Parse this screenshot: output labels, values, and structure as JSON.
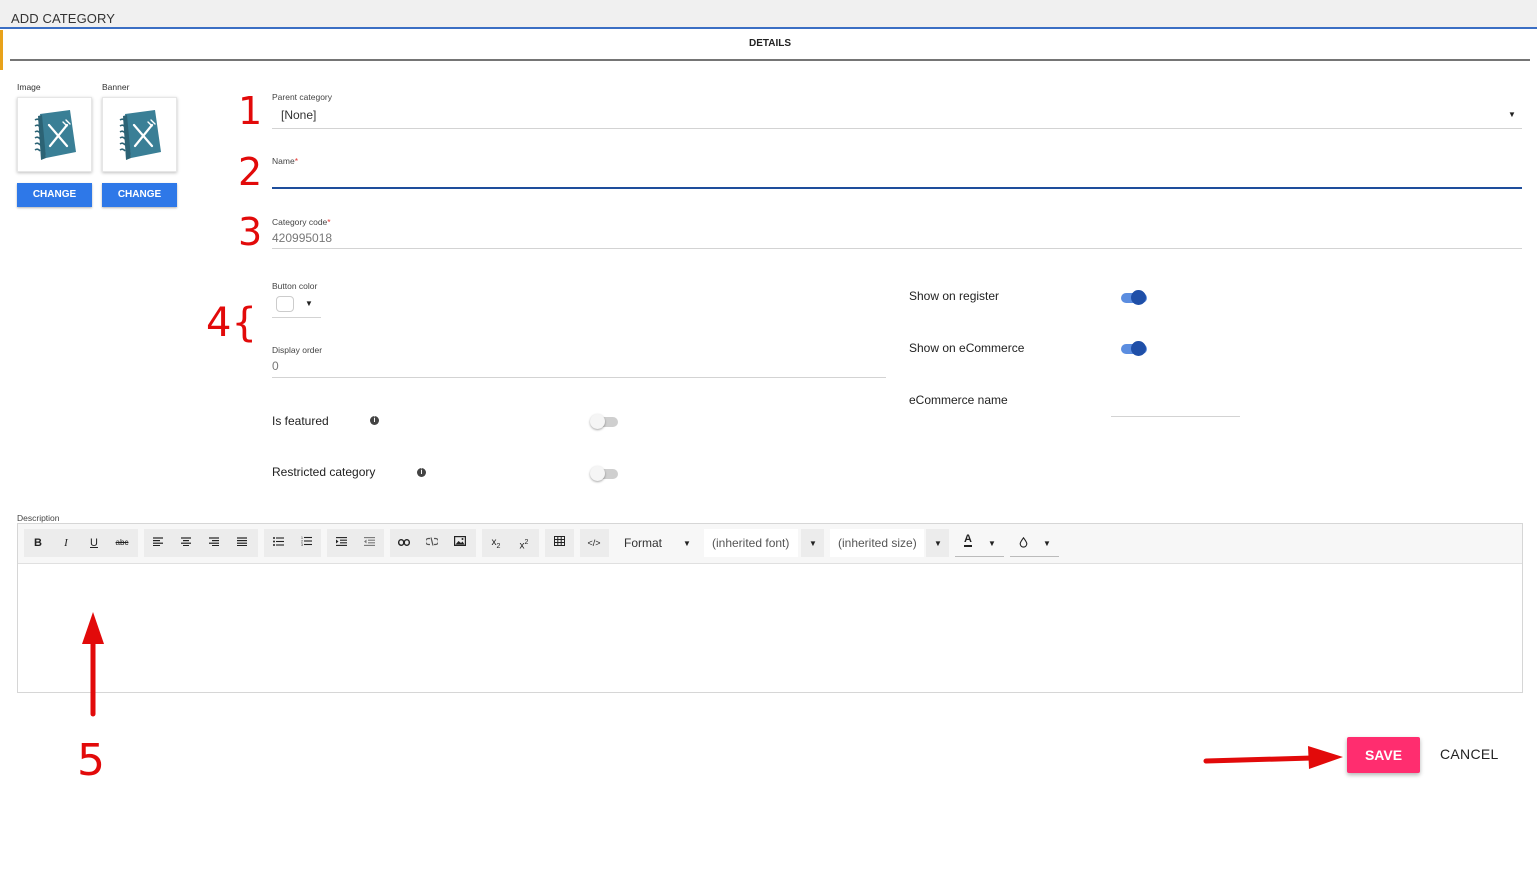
{
  "window": {
    "title": "ADD CATEGORY"
  },
  "tabs": [
    {
      "label": "DETAILS"
    }
  ],
  "media": {
    "image_label": "Image",
    "banner_label": "Banner",
    "change_label": "CHANGE",
    "icon": "recipe-book-fork-knife-icon"
  },
  "form": {
    "parent_category": {
      "label": "Parent category",
      "value": "[None]"
    },
    "name": {
      "label": "Name",
      "required_mark": "*",
      "value": ""
    },
    "category_code": {
      "label": "Category code",
      "required_mark": "*",
      "value": "420995018"
    },
    "button_color": {
      "label": "Button color",
      "value": "#ffffff"
    },
    "display_order": {
      "label": "Display order",
      "value": "0"
    },
    "is_featured": {
      "label": "Is featured",
      "on": false
    },
    "restricted_category": {
      "label": "Restricted category",
      "on": false
    },
    "show_on_register": {
      "label": "Show on register",
      "on": true
    },
    "show_on_ecommerce": {
      "label": "Show on eCommerce",
      "on": true
    },
    "ecommerce_name": {
      "label": "eCommerce name",
      "value": ""
    },
    "description": {
      "label": "Description"
    }
  },
  "editor_toolbar": {
    "format_label": "Format",
    "font_value": "(inherited font)",
    "size_value": "(inherited size)",
    "text_color_glyph": "A"
  },
  "actions": {
    "save_label": "SAVE",
    "cancel_label": "CANCEL"
  },
  "annotations": {
    "one": "1",
    "two": "2",
    "three": "3",
    "four": "4{",
    "five": "5"
  },
  "colors": {
    "accent": "#2e78e8",
    "save": "#ff2d6f",
    "toggle_on": "#1f4fa8",
    "annotation": "#e20a0a"
  }
}
